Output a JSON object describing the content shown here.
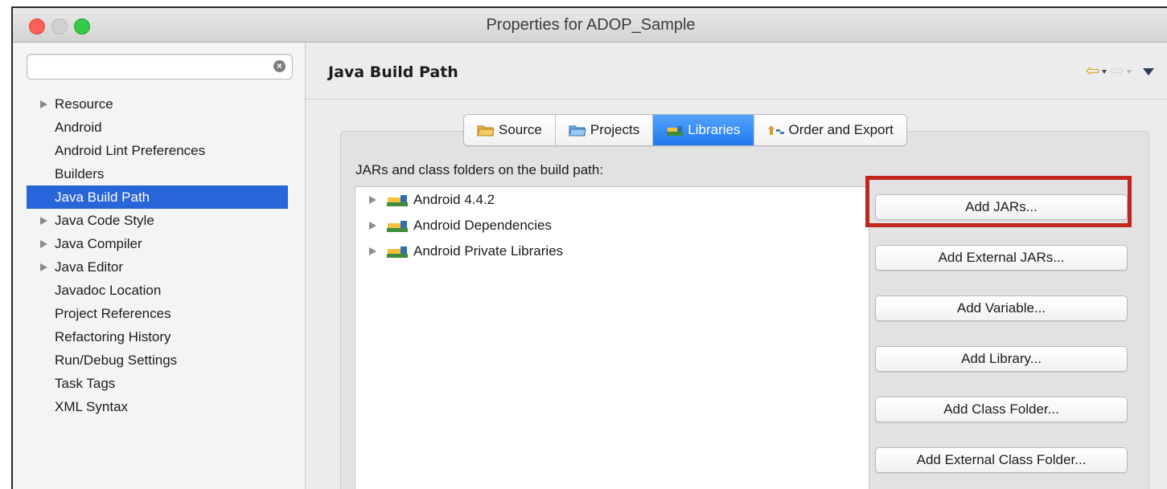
{
  "window": {
    "title": "Properties for ADOP_Sample"
  },
  "sidebar": {
    "filter_value": "",
    "items": [
      {
        "label": "Resource",
        "expandable": true
      },
      {
        "label": "Android",
        "expandable": false
      },
      {
        "label": "Android Lint Preferences",
        "expandable": false
      },
      {
        "label": "Builders",
        "expandable": false
      },
      {
        "label": "Java Build Path",
        "expandable": false,
        "selected": true
      },
      {
        "label": "Java Code Style",
        "expandable": true
      },
      {
        "label": "Java Compiler",
        "expandable": true
      },
      {
        "label": "Java Editor",
        "expandable": true
      },
      {
        "label": "Javadoc Location",
        "expandable": false
      },
      {
        "label": "Project References",
        "expandable": false
      },
      {
        "label": "Refactoring History",
        "expandable": false
      },
      {
        "label": "Run/Debug Settings",
        "expandable": false
      },
      {
        "label": "Task Tags",
        "expandable": false
      },
      {
        "label": "XML Syntax",
        "expandable": false
      }
    ]
  },
  "main": {
    "title": "Java Build Path",
    "tabs": [
      {
        "label": "Source",
        "icon": "source-folder-icon"
      },
      {
        "label": "Projects",
        "icon": "projects-folder-icon"
      },
      {
        "label": "Libraries",
        "icon": "libraries-icon",
        "active": true
      },
      {
        "label": "Order and Export",
        "icon": "order-export-icon"
      }
    ],
    "section_label": "JARs and class folders on the build path:",
    "libraries": [
      {
        "label": "Android 4.4.2"
      },
      {
        "label": "Android Dependencies"
      },
      {
        "label": "Android Private Libraries"
      }
    ],
    "buttons": {
      "add_jars": "Add JARs...",
      "add_external_jars": "Add External JARs...",
      "add_variable": "Add Variable...",
      "add_library": "Add Library...",
      "add_class_folder": "Add Class Folder...",
      "add_external_class_folder": "Add External Class Folder..."
    }
  },
  "colors": {
    "selection": "#2865d9",
    "active_tab": "#1f78f0",
    "highlight_box": "#c1271c",
    "close": "#fc5f57",
    "maximize": "#35c94a"
  }
}
